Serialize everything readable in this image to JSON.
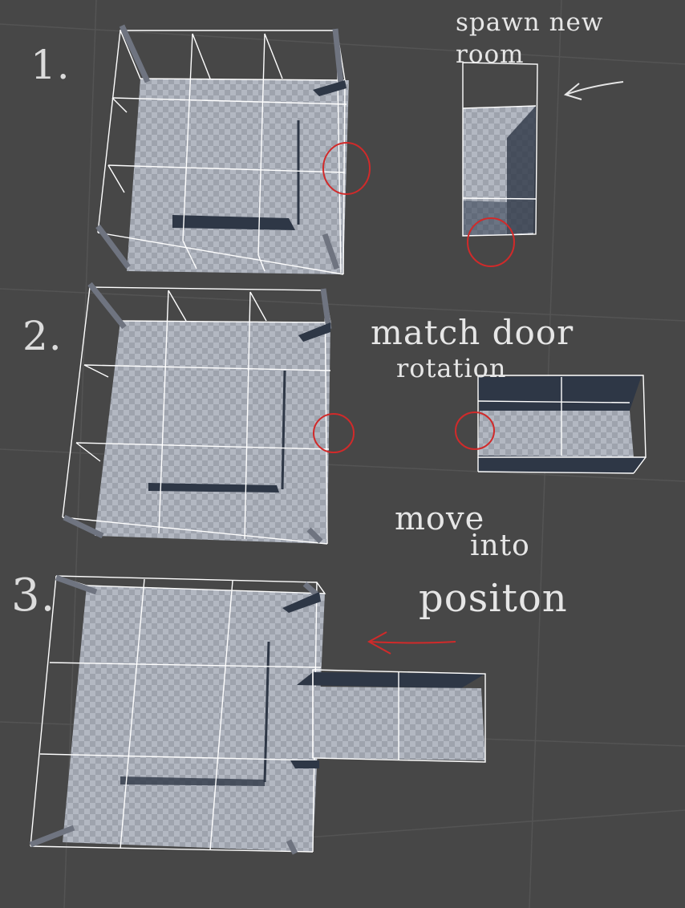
{
  "steps": [
    {
      "number": "1.",
      "label": "spawn new room"
    },
    {
      "number": "2.",
      "label_line1": "match door",
      "label_line2": "rotation"
    },
    {
      "number": "3.",
      "label_line1": "move",
      "label_line2": "into",
      "label_line3": "positon"
    }
  ],
  "colors": {
    "background": "#474747",
    "grid_line": "#545454",
    "floor_light": "#b3b8c2",
    "floor_dark": "#9ea3ad",
    "wire": "#ffffff",
    "shadow": "#2e3746",
    "pillar": "#6f7480",
    "annotation_red": "#d12a2a",
    "text": "#e6e6e6"
  }
}
